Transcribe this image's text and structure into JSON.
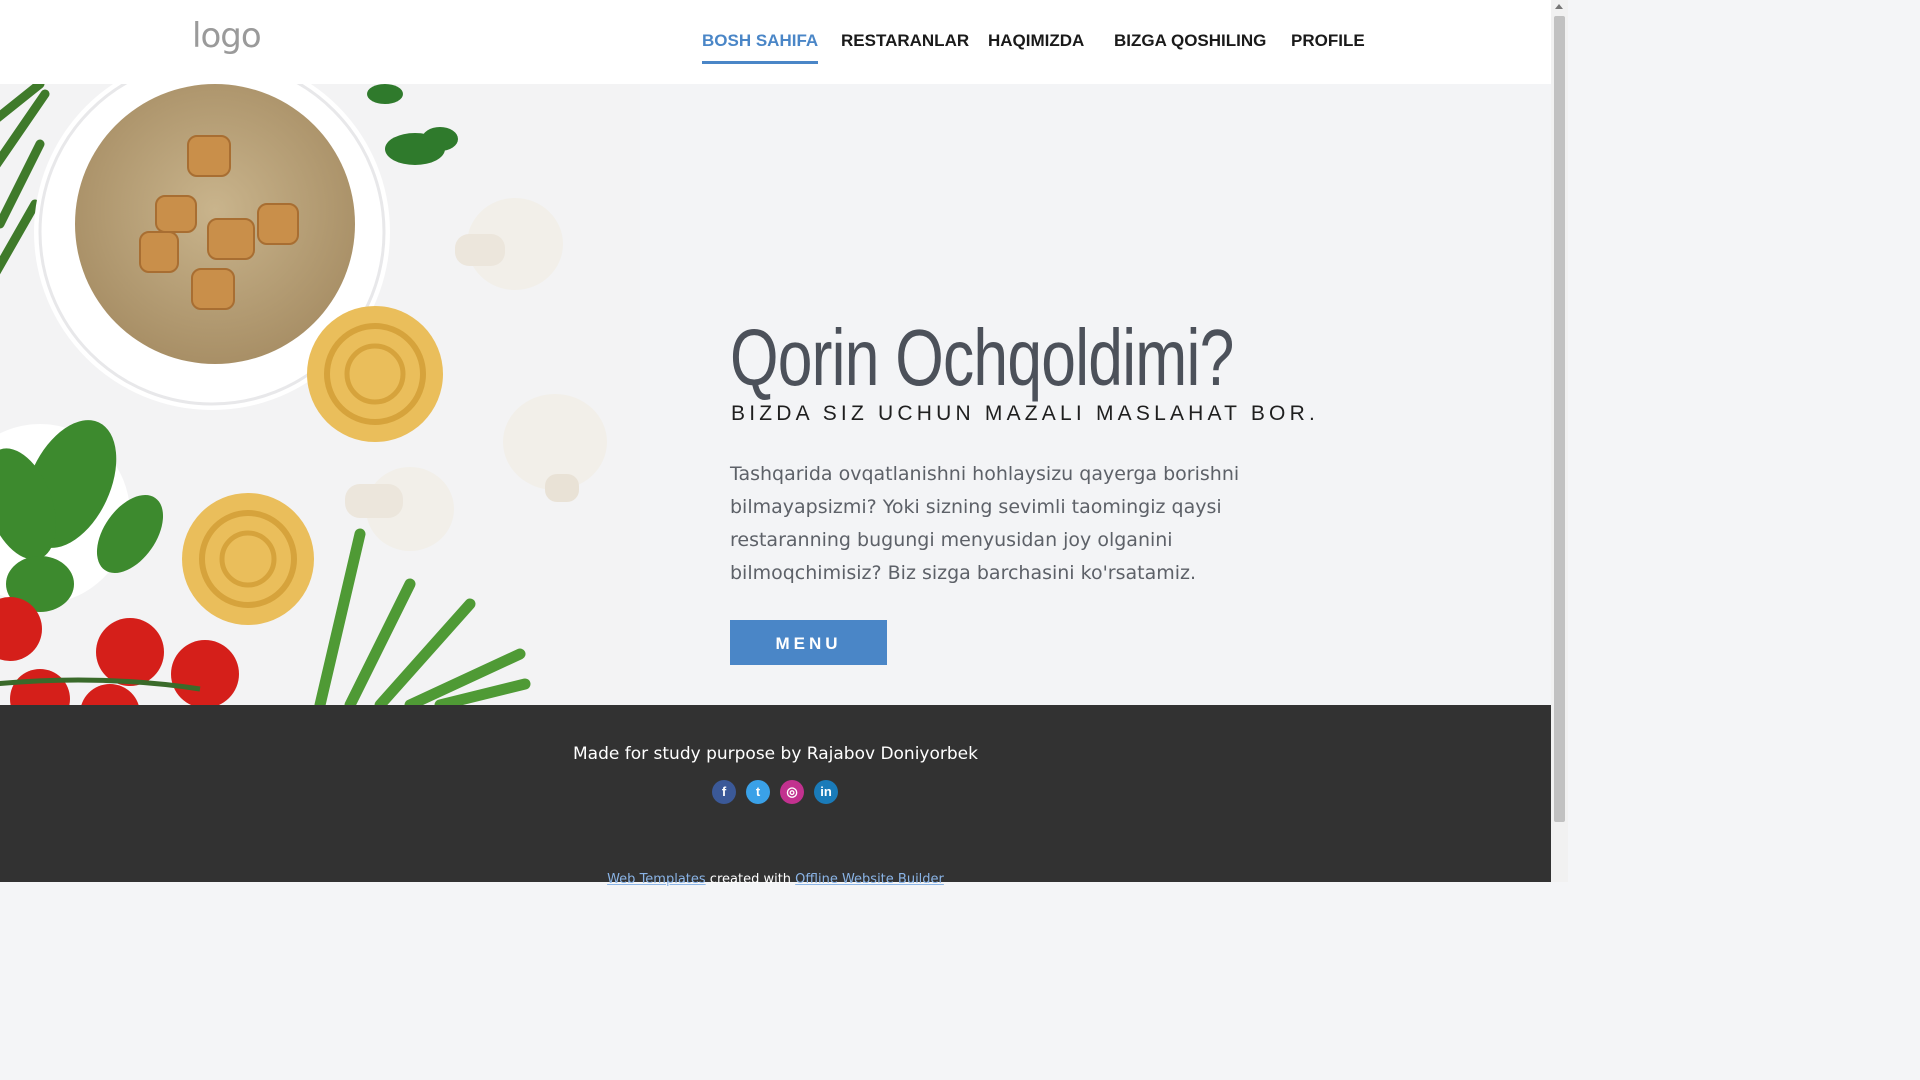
{
  "header": {
    "logo_text": "logo",
    "nav": [
      {
        "label": "BOSH SAHIFA",
        "active": true
      },
      {
        "label": "RESTARANLAR",
        "active": false
      },
      {
        "label": "HAQIMIZDA",
        "active": false
      },
      {
        "label": "BIZGA QOSHILING",
        "active": false
      },
      {
        "label": "PROFILE",
        "active": false
      }
    ]
  },
  "hero": {
    "title": "Qorin Ochqoldimi?",
    "subtitle": "BIZDA SIZ UCHUN MAZALI MASLAHAT BOR.",
    "text": "Tashqarida ovqatlanishni hohlaysizu qayerga borishni bilmayapsizmi? Yoki sizning sevimli taomingiz qaysi restaranning bugungi menyusidan joy olganini bilmoqchimisiz?  Biz sizga barchasini ko'rsatamiz.",
    "button_label": "MENU"
  },
  "footer": {
    "credit": "Made for study purpose by Rajabov Doniyorbek",
    "socials": [
      {
        "icon": "facebook-icon",
        "glyph": "f",
        "color": "#3b5998"
      },
      {
        "icon": "twitter-icon",
        "glyph": "t",
        "color": "#3aa1e8"
      },
      {
        "icon": "instagram-icon",
        "glyph": "◎",
        "color": "#c2318f"
      },
      {
        "icon": "linkedin-icon",
        "glyph": "in",
        "color": "#1a7bb9"
      }
    ],
    "link1": "Web Templates",
    "middle": " created with ",
    "link2": "Offline Website Builder"
  },
  "colors": {
    "accent": "#4a86c7",
    "footer_bg": "#323232"
  }
}
